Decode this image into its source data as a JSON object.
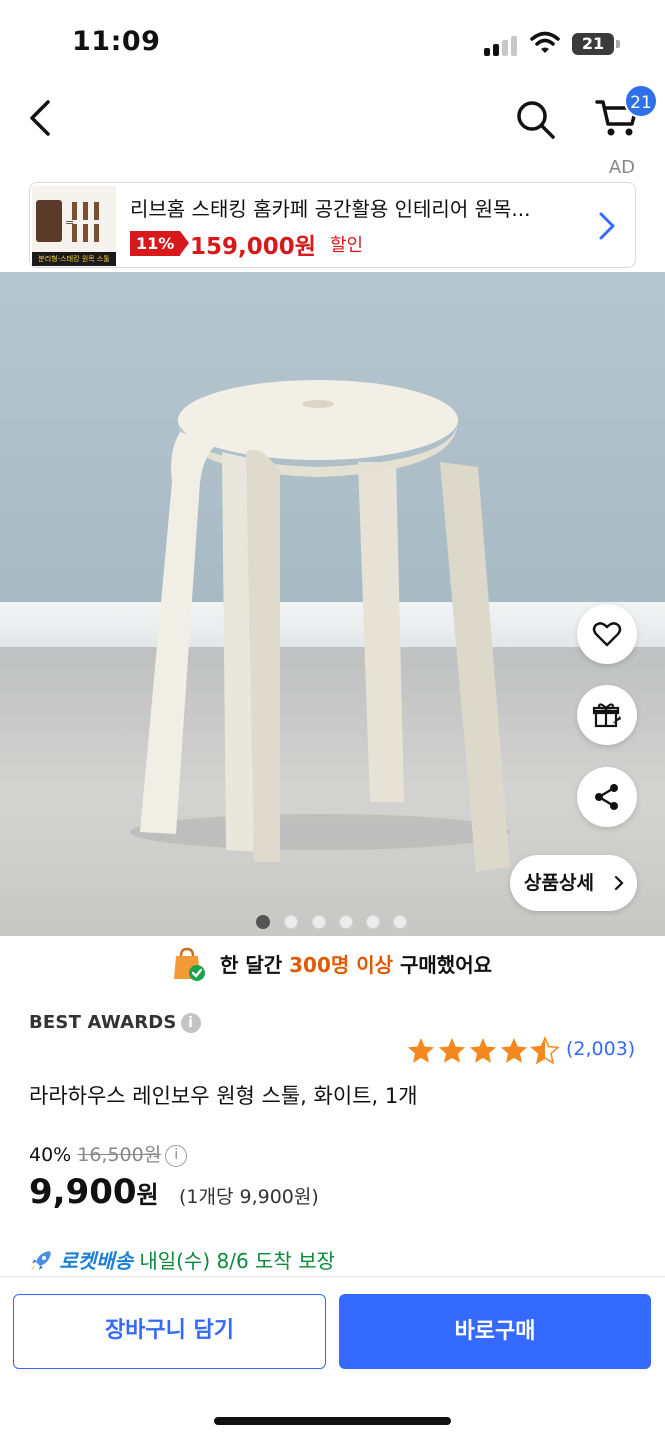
{
  "status_bar": {
    "time": "11:09",
    "battery": "21",
    "icons": [
      "cellular-signal-icon",
      "wifi-icon",
      "battery-icon"
    ]
  },
  "nav": {
    "icons": [
      "back-chevron-icon",
      "search-icon",
      "cart-icon"
    ],
    "cart_badge": "21"
  },
  "ad": {
    "label": "AD",
    "title": "리브홈 스태킹 홈카페 공간활용 인테리어 원목...",
    "discount": "11%",
    "price": "159,000원",
    "sale_label": "할인",
    "thumb_caption": "분리형-스태킹 원목 스툴"
  },
  "gallery": {
    "total_images": 6,
    "active_index": 0,
    "side_buttons": [
      "heart-icon",
      "gift-icon",
      "share-icon"
    ],
    "detail_button": "상품상세"
  },
  "purchase_info": {
    "prefix": "한 달간",
    "highlight": "300명 이상",
    "suffix": "구매했어요"
  },
  "product": {
    "award": "BEST AWARDS",
    "rating": 4.5,
    "rating_count": "(2,003)",
    "name": "라라하우스 레인보우 원형 스툴, 화이트, 1개",
    "discount_rate": "40%",
    "original_price": "16,500원",
    "price_number": "9,900",
    "price_unit": "원",
    "unit_price": "(1개당 9,900원)"
  },
  "delivery": {
    "badge": "로켓배송",
    "text": "내일(수) 8/6 도착 보장"
  },
  "actions": {
    "add_to_cart": "장바구니 담기",
    "buy_now": "바로구매"
  },
  "colors": {
    "accent_blue": "#346aff",
    "price_red": "#d7191c",
    "highlight_orange": "#e05a00",
    "star_orange": "#f5891f"
  }
}
